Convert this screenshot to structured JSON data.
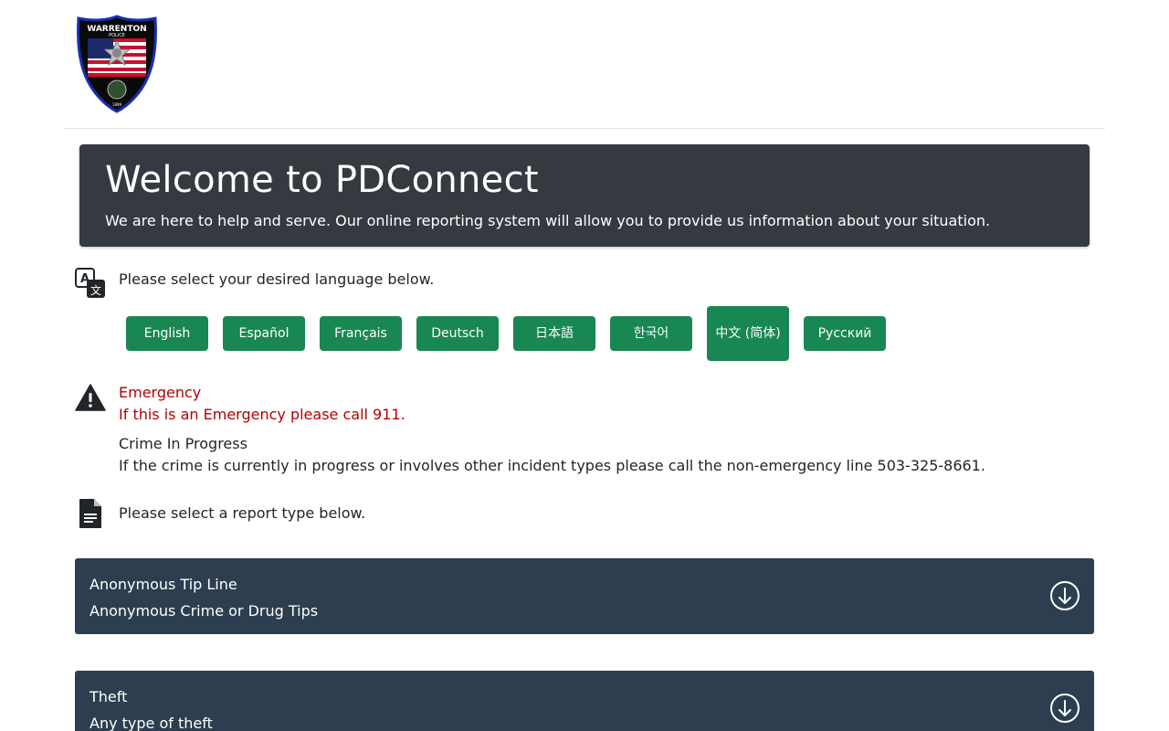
{
  "logo": {
    "name": "Warrenton Police badge",
    "top_text": "WARRENTON",
    "sub_text": "POLICE",
    "year": "1899"
  },
  "hero": {
    "title": "Welcome to PDConnect",
    "subtitle": "We are here to help and serve. Our online reporting system will allow you to provide us information about your situation."
  },
  "language": {
    "icon": "translate-icon",
    "prompt": "Please select your desired language below.",
    "buttons": [
      "English",
      "Español",
      "Français",
      "Deutsch",
      "日本語",
      "한국어",
      "中文 (简体)",
      "Русский"
    ]
  },
  "emergency": {
    "icon": "warning-icon",
    "title": "Emergency",
    "text": "If this is an Emergency please call 911."
  },
  "crime_in_progress": {
    "title": "Crime In Progress",
    "text": "If the crime is currently in progress or involves other incident types please call the non-emergency line 503-325-8661."
  },
  "report": {
    "icon": "document-icon",
    "prompt": "Please select a report type below.",
    "types": [
      {
        "title": "Anonymous Tip Line",
        "description": "Anonymous Crime or Drug Tips"
      },
      {
        "title": "Theft",
        "description": "Any type of theft"
      }
    ]
  },
  "colors": {
    "hero_bg": "#343a40",
    "button_green": "#198754",
    "card_bg": "#2d3e50",
    "emergency_red": "#b30000"
  }
}
